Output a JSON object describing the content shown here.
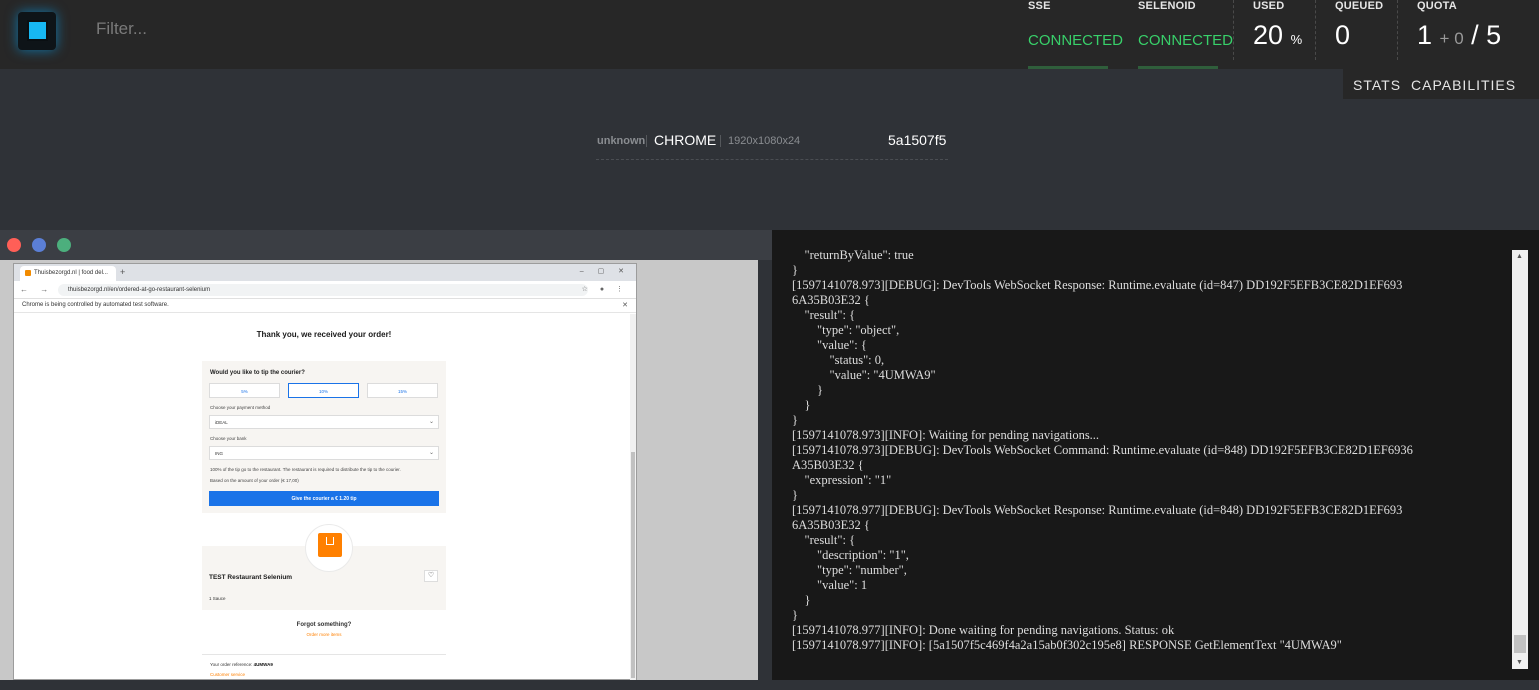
{
  "header": {
    "filter_placeholder": "Filter...",
    "sse": {
      "label": "SSE",
      "value": "CONNECTED"
    },
    "selenoid": {
      "label": "SELENOID",
      "value": "CONNECTED"
    },
    "used": {
      "label": "USED",
      "value": "20",
      "unit": "%"
    },
    "queued": {
      "label": "QUEUED",
      "value": "0"
    },
    "quota": {
      "label": "QUOTA",
      "value": "1",
      "extra": "+ 0",
      "total": "/ 5"
    }
  },
  "nav": {
    "stats": "STATS",
    "capabilities": "CAPABILITIES"
  },
  "session": {
    "name": "unknown",
    "browser": "CHROME",
    "resolution": "1920x1080x24",
    "id": "5a1507f5"
  },
  "colors": {
    "connected": "#38d06a",
    "accent": "#17b8f3",
    "close": "#ff5f57",
    "min": "#5b7fd6",
    "max": "#4caf7d"
  },
  "vnc": {
    "tab_title": "Thuisbezorgd.nl | food del...",
    "url": "thuisbezorgd.nl/en/ordered-at-go-restaurant-selenium",
    "infobar": "Chrome is being controlled by automated test software.",
    "page": {
      "heading": "Thank you, we received your order!",
      "tip_question": "Would you like to tip the courier?",
      "tip_options": [
        "5%",
        "10%",
        "15%"
      ],
      "payment_label": "Choose your payment method",
      "payment_value": "iDEAL",
      "bank_label": "Choose your bank",
      "bank_value": "ING",
      "tip_note": "100% of the tip go to the restaurant. The restaurant is required to distribute the tip to the courier.",
      "tip_amount": "Based on the amount of your order (€ 17,00)",
      "tip_button": "Give the courier a € 1.20 tip",
      "restaurant_name": "TEST Restaurant Selenium",
      "order_line": "1    Sauce",
      "forgot": "Forgot something?",
      "forgot_link": "Order more items",
      "ref_label": "Your order reference:",
      "ref_value": "4UMWA9",
      "customer_service": "Customer service"
    }
  },
  "log": {
    "lines": [
      "    \"returnByValue\": true",
      "}",
      "[1597141078.973][DEBUG]: DevTools WebSocket Response: Runtime.evaluate (id=847) DD192F5EFB3CE82D1EF693",
      "6A35B03E32 {",
      "    \"result\": {",
      "        \"type\": \"object\",",
      "        \"value\": {",
      "            \"status\": 0,",
      "            \"value\": \"4UMWA9\"",
      "        }",
      "    }",
      "}",
      "[1597141078.973][INFO]: Waiting for pending navigations...",
      "[1597141078.973][DEBUG]: DevTools WebSocket Command: Runtime.evaluate (id=848) DD192F5EFB3CE82D1EF6936",
      "A35B03E32 {",
      "    \"expression\": \"1\"",
      "}",
      "[1597141078.977][DEBUG]: DevTools WebSocket Response: Runtime.evaluate (id=848) DD192F5EFB3CE82D1EF693",
      "6A35B03E32 {",
      "    \"result\": {",
      "        \"description\": \"1\",",
      "        \"type\": \"number\",",
      "        \"value\": 1",
      "    }",
      "}",
      "[1597141078.977][INFO]: Done waiting for pending navigations. Status: ok",
      "[1597141078.977][INFO]: [5a1507f5c469f4a2a15ab0f302c195e8] RESPONSE GetElementText \"4UMWA9\""
    ]
  }
}
